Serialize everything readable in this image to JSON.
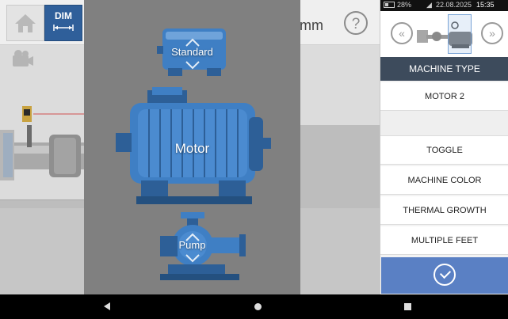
{
  "toolbar": {
    "dim_label": "DIM",
    "unit_label": "mm",
    "help_label": "?"
  },
  "picker": {
    "options": [
      {
        "label": "Standard"
      },
      {
        "label": "Motor"
      },
      {
        "label": "Pump"
      }
    ],
    "selected": "Motor"
  },
  "status": {
    "battery": "28%",
    "date": "22.08.2025",
    "time": "15:35"
  },
  "panel": {
    "section_title": "MACHINE TYPE",
    "machine_name": "MOTOR 2",
    "options": [
      "TOGGLE",
      "MACHINE COLOR",
      "THERMAL GROWTH",
      "MULTIPLE FEET"
    ]
  },
  "colors": {
    "machine_blue": "#3f7fc4",
    "header_dark": "#3d4b5c",
    "confirm_blue": "#5a80c4"
  }
}
